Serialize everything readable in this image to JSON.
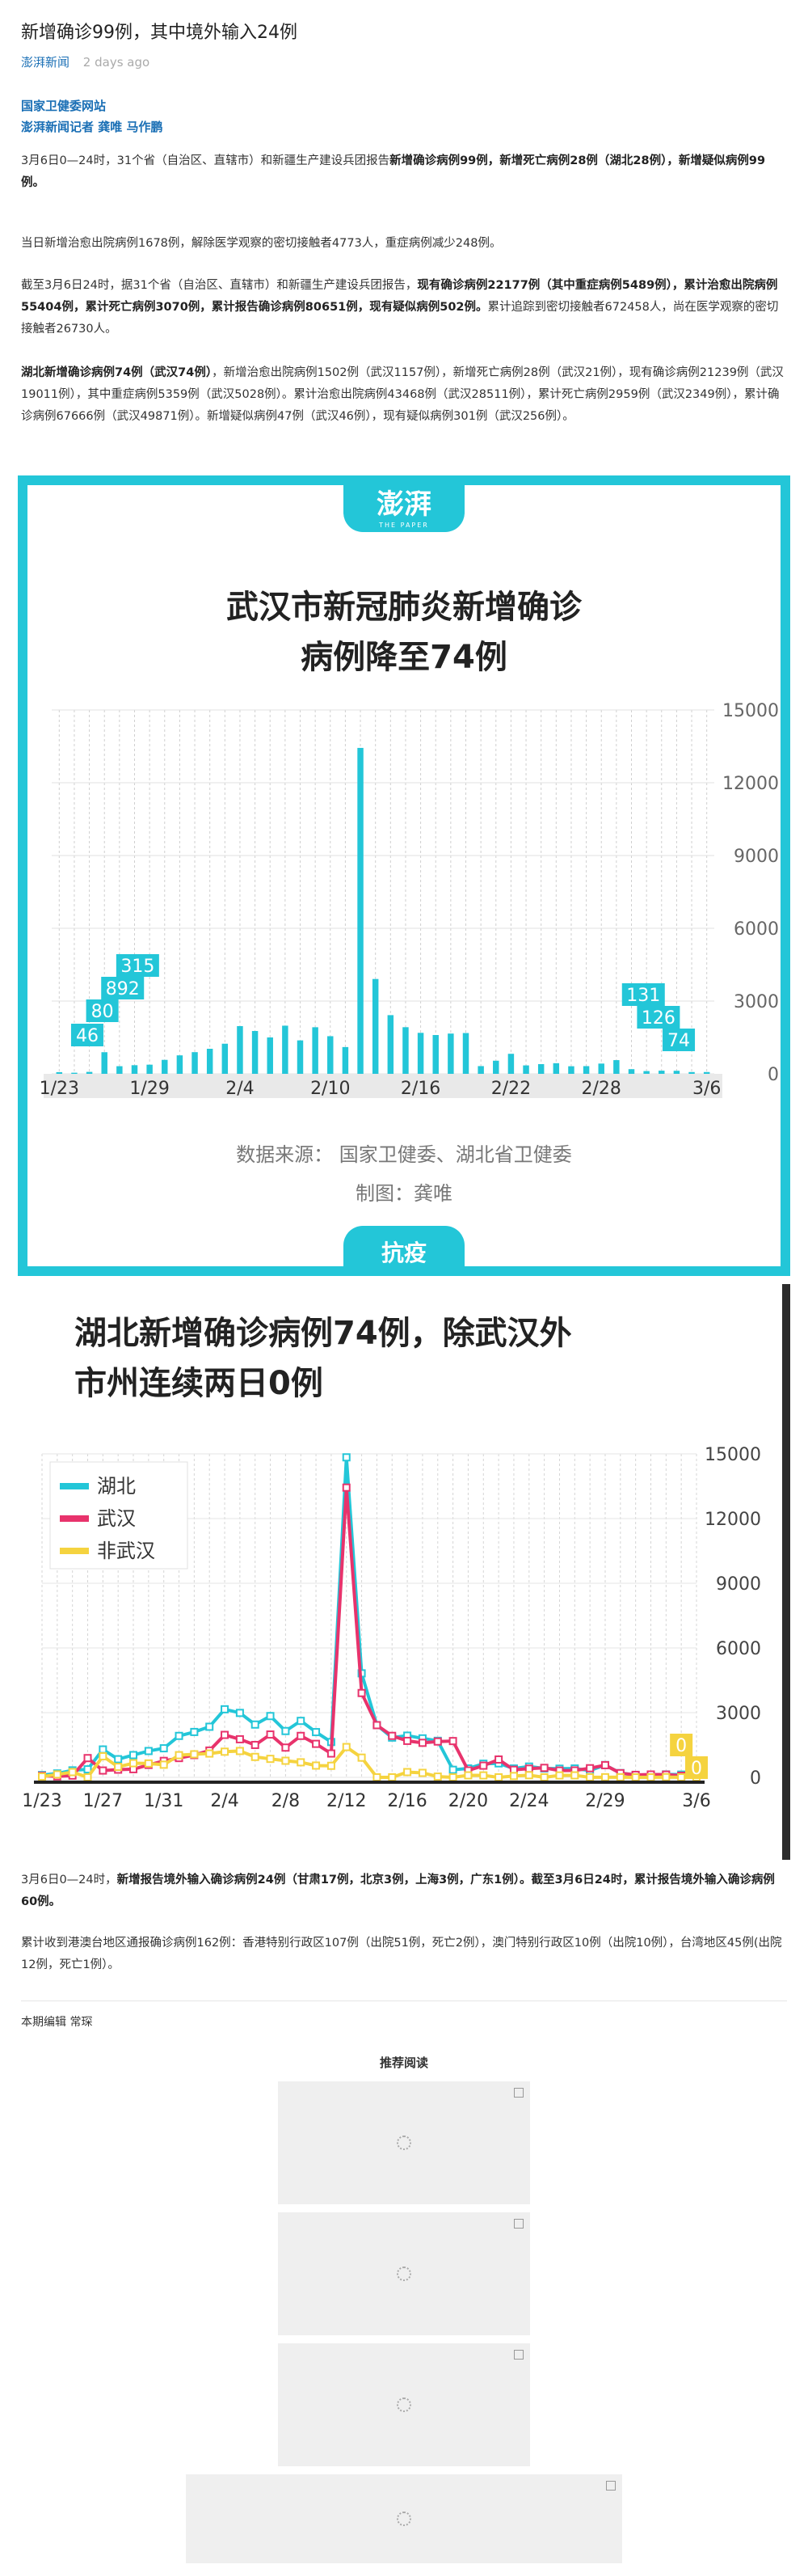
{
  "article": {
    "title": "新增确诊99例，其中境外输入24例",
    "source": "澎湃新闻",
    "time": "2 days ago",
    "byline_1": "国家卫健委网站",
    "byline_2": "澎湃新闻记者 龚唯 马作鹏",
    "p1": [
      {
        "t": "3月6日0—24时，31个省（自治区、直辖市）和新疆生产建设兵团报告",
        "b": false
      },
      {
        "t": "新增确诊病例99例，新增死亡病例28例（湖北28例），新增疑似病例99例。",
        "b": true
      }
    ],
    "p2": [
      {
        "t": "当日新增治愈出院病例1678例，解除医学观察的密切接触者4773人，重症病例减少248例。",
        "b": false
      }
    ],
    "p3": [
      {
        "t": "截至3月6日24时，据31个省（自治区、直辖市）和新疆生产建设兵团报告，",
        "b": false
      },
      {
        "t": "现有确诊病例22177例（其中重症病例5489例），累计治愈出院病例55404例，累计死亡病例3070例，累计报告确诊病例80651例，现有疑似病例502例。",
        "b": true
      },
      {
        "t": "累计追踪到密切接触者672458人，尚在医学观察的密切接触者26730人。",
        "b": false
      }
    ],
    "p4": [
      {
        "t": "湖北新增确诊病例74例（武汉74例）",
        "b": true
      },
      {
        "t": "，新增治愈出院病例1502例（武汉1157例），新增死亡病例28例（武汉21例），现有确诊病例21239例（武汉19011例），其中重症病例5359例（武汉5028例）。累计治愈出院病例43468例（武汉28511例），累计死亡病例2959例（武汉2349例），累计确诊病例67666例（武汉49871例）。新增疑似病例47例（武汉46例），现有疑似病例301例（武汉256例）。",
        "b": false
      }
    ],
    "p5": [
      {
        "t": "3月6日0—24时，",
        "b": false
      },
      {
        "t": "新增报告境外输入确诊病例24例（甘肃17例，北京3例，上海3例，广东1例）。截至3月6日24时，累计报告境外输入确诊病例60例。",
        "b": true
      }
    ],
    "p6": [
      {
        "t": "累计收到港澳台地区通报确诊病例162例：香港特别行政区107例（出院51例，死亡2例），澳门特别行政区10例（出院10例），台湾地区45例(出院12例，死亡1例）。",
        "b": false
      }
    ],
    "editor": "本期编辑 常琛",
    "recommend_title": "推荐阅读"
  },
  "figure1": {
    "brand_logo": "澎湃",
    "brand_sub": "THE PAPER",
    "title_line1": "武汉市新冠肺炎新增确诊",
    "title_line2": "病例降至74例",
    "source": "数据来源：  国家卫健委、湖北省卫健委",
    "maker": "制图：龚唯",
    "tag": "抗疫",
    "accent": "#23c6d8",
    "bar_color": "#23c6d8"
  },
  "figure2": {
    "title_line1": "湖北新增确诊病例74例，除武汉外",
    "title_line2": "市州连续两日0例",
    "colors": {
      "hubei": "#23c6d8",
      "wuhan": "#e8336c",
      "other": "#f5d33f"
    }
  },
  "chart_data": [
    {
      "type": "bar",
      "title": "武汉市新冠肺炎新增确诊病例降至74例",
      "categories": [
        "1/23",
        "1/24",
        "1/25",
        "1/26",
        "1/27",
        "1/28",
        "1/29",
        "1/30",
        "1/31",
        "2/1",
        "2/2",
        "2/3",
        "2/4",
        "2/5",
        "2/6",
        "2/7",
        "2/8",
        "2/9",
        "2/10",
        "2/11",
        "2/12",
        "2/13",
        "2/14",
        "2/15",
        "2/16",
        "2/17",
        "2/18",
        "2/19",
        "2/20",
        "2/21",
        "2/22",
        "2/23",
        "2/24",
        "2/25",
        "2/26",
        "2/27",
        "2/28",
        "2/29",
        "3/1",
        "3/2",
        "3/3",
        "3/4",
        "3/5",
        "3/6"
      ],
      "x_tick_labels": [
        "1/23",
        "1/29",
        "2/4",
        "2/10",
        "2/16",
        "2/22",
        "2/28",
        "3/6"
      ],
      "values": [
        70,
        46,
        80,
        892,
        315,
        356,
        378,
        576,
        762,
        894,
        1033,
        1242,
        1967,
        1766,
        1501,
        1985,
        1379,
        1921,
        1552,
        1104,
        13436,
        3910,
        2420,
        1923,
        1690,
        1600,
        1660,
        1682,
        319,
        541,
        826,
        348,
        401,
        439,
        313,
        318,
        423,
        565,
        193,
        114,
        131,
        126,
        74,
        74
      ],
      "data_labels": [
        {
          "category": "1/24",
          "text": "46"
        },
        {
          "category": "1/25",
          "text": "80"
        },
        {
          "category": "1/26",
          "text": "892"
        },
        {
          "category": "1/27",
          "text": "315"
        },
        {
          "category": "3/3",
          "text": "131"
        },
        {
          "category": "3/4",
          "text": "126"
        },
        {
          "category": "3/5",
          "text": "74"
        }
      ],
      "y_ticks": [
        "0",
        "3000",
        "6000",
        "9000",
        "12000",
        "15000"
      ],
      "ylim": [
        0,
        15000
      ],
      "grid": true
    },
    {
      "type": "line",
      "title": "湖北新增确诊病例74例，除武汉外市州连续两日0例",
      "categories": [
        "1/23",
        "1/24",
        "1/25",
        "1/26",
        "1/27",
        "1/28",
        "1/29",
        "1/30",
        "1/31",
        "2/1",
        "2/2",
        "2/3",
        "2/4",
        "2/5",
        "2/6",
        "2/7",
        "2/8",
        "2/9",
        "2/10",
        "2/11",
        "2/12",
        "2/13",
        "2/14",
        "2/15",
        "2/16",
        "2/17",
        "2/18",
        "2/19",
        "2/20",
        "2/21",
        "2/22",
        "2/23",
        "2/24",
        "2/25",
        "2/26",
        "2/27",
        "2/28",
        "2/29",
        "3/1",
        "3/2",
        "3/3",
        "3/4",
        "3/5",
        "3/6"
      ],
      "x_tick_labels": [
        "1/23",
        "1/27",
        "1/31",
        "2/4",
        "2/8",
        "2/12",
        "2/16",
        "2/20",
        "2/24",
        "2/29",
        "3/6"
      ],
      "series": [
        {
          "name": "湖北",
          "values": [
            105,
            180,
            323,
            371,
            1291,
            840,
            1032,
            1220,
            1347,
            1921,
            2103,
            2345,
            3156,
            2987,
            2447,
            2841,
            2147,
            2618,
            2097,
            1638,
            14840,
            4823,
            2420,
            1843,
            1933,
            1807,
            1693,
            349,
            411,
            630,
            648,
            409,
            499,
            411,
            401,
            409,
            318,
            570,
            196,
            114,
            115,
            134,
            126,
            74
          ]
        },
        {
          "name": "武汉",
          "values": [
            70,
            46,
            80,
            892,
            315,
            356,
            378,
            576,
            762,
            894,
            1033,
            1242,
            1967,
            1766,
            1501,
            1985,
            1379,
            1921,
            1552,
            1104,
            13436,
            3910,
            2420,
            1923,
            1690,
            1600,
            1660,
            1682,
            319,
            541,
            826,
            348,
            401,
            439,
            313,
            318,
            423,
            565,
            193,
            114,
            131,
            126,
            74,
            74
          ]
        },
        {
          "name": "非武汉",
          "values": [
            35,
            134,
            243,
            0,
            976,
            484,
            654,
            644,
            585,
            1027,
            1070,
            1103,
            1189,
            1221,
            946,
            856,
            768,
            697,
            545,
            534,
            1404,
            913,
            0,
            0,
            243,
            207,
            33,
            0,
            92,
            89,
            0,
            61,
            98,
            0,
            88,
            91,
            0,
            5,
            3,
            0,
            0,
            8,
            0,
            0
          ]
        }
      ],
      "data_labels": [
        {
          "series": "非武汉",
          "category": "3/5",
          "text": "0"
        },
        {
          "series": "非武汉",
          "category": "3/6",
          "text": "0"
        }
      ],
      "y_ticks": [
        "0",
        "3000",
        "6000",
        "9000",
        "12000",
        "15000"
      ],
      "ylim": [
        0,
        15000
      ],
      "legend": "top-left",
      "grid": true
    }
  ]
}
